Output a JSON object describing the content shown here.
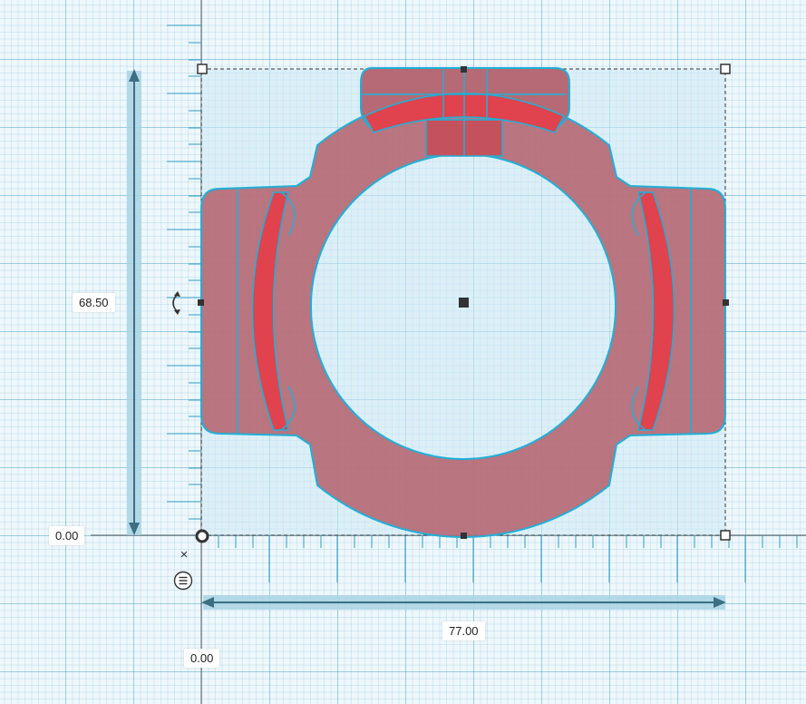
{
  "dimensions": {
    "height": "68.50",
    "width": "77.00",
    "origin_x": "0.00",
    "origin_y": "0.00"
  },
  "controls": {
    "close_glyph": "×",
    "menu_icon": "list-icon",
    "rotate_icon": "rotate-arrow-icon"
  },
  "colors": {
    "shape_fill": "#b56a75",
    "highlight_fill": "#e0424e",
    "outline": "#1fb0d8",
    "selection_fill": "#cde9f4",
    "dimension_bar": "#a8d3e4",
    "dimension_arrow": "#3d6f82"
  }
}
